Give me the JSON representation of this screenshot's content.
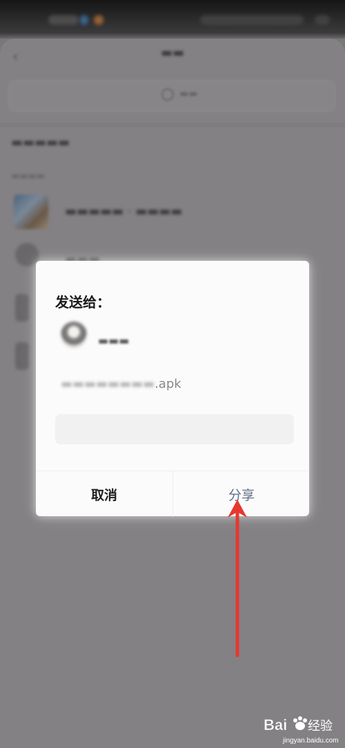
{
  "status_bar": {
    "blur_colors": [
      "#5a5a5a",
      "#3b7fb6",
      "#c77a3a",
      "#4a4a4a"
    ]
  },
  "background_app": {
    "rows": [
      {
        "thumb_color": "#5c6f86"
      },
      {
        "thumb_color": "#6d6b6d"
      },
      {
        "thumb_color": "#6d6b6d"
      },
      {
        "thumb_color": "#6d6b6d"
      }
    ]
  },
  "dialog": {
    "title": "发送给：",
    "file_suffix": ".apk",
    "cancel_label": "取消",
    "share_label": "分享"
  },
  "annotation": {
    "arrow_color": "#e8372f"
  },
  "watermark": {
    "brand_text": "Bai 经验",
    "url_text": "jingyan.baidu.com"
  }
}
